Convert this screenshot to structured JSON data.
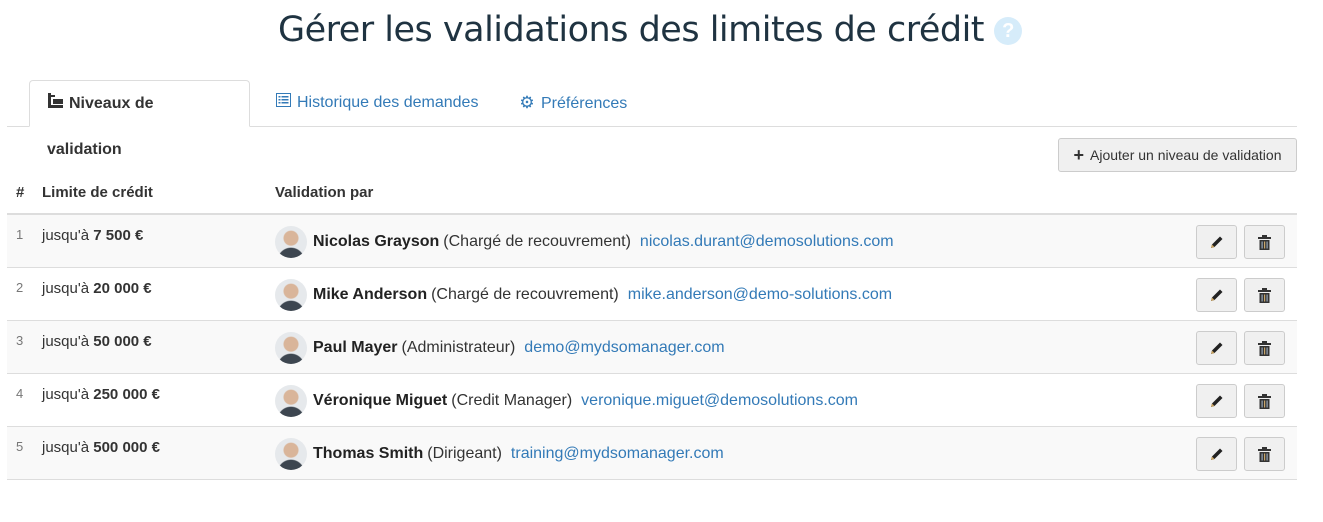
{
  "page": {
    "title": "Gérer les validations des limites de crédit",
    "help_icon": "question-circle-icon"
  },
  "tabs": [
    {
      "label": "Niveaux de validation",
      "icon": "sitemap-icon",
      "active": true
    },
    {
      "label": "Historique des demandes",
      "icon": "list-alt-icon",
      "active": false
    },
    {
      "label": "Préférences",
      "icon": "gear-icon",
      "active": false
    }
  ],
  "toolbar": {
    "add_label": "Ajouter un niveau de validation",
    "add_icon": "plus-icon"
  },
  "table": {
    "headers": {
      "num": "#",
      "limit": "Limite de crédit",
      "validator": "Validation par"
    },
    "rows": [
      {
        "num": "1",
        "prefix": "jusqu'à",
        "amount": "7 500 €",
        "name": "Nicolas Grayson",
        "role": "(Chargé de recouvrement)",
        "email": "nicolas.durant@demosolutions.com"
      },
      {
        "num": "2",
        "prefix": "jusqu'à",
        "amount": "20 000 €",
        "name": "Mike Anderson",
        "role": "(Chargé de recouvrement)",
        "email": "mike.anderson@demo-solutions.com"
      },
      {
        "num": "3",
        "prefix": "jusqu'à",
        "amount": "50 000 €",
        "name": "Paul Mayer",
        "role": "(Administrateur)",
        "email": "demo@mydsomanager.com"
      },
      {
        "num": "4",
        "prefix": "jusqu'à",
        "amount": "250 000 €",
        "name": "Véronique Miguet",
        "role": "(Credit Manager)",
        "email": "veronique.miguet@demosolutions.com"
      },
      {
        "num": "5",
        "prefix": "jusqu'à",
        "amount": "500 000 €",
        "name": "Thomas Smith",
        "role": "(Dirigeant)",
        "email": "training@mydsomanager.com"
      }
    ],
    "row_actions": {
      "edit_icon": "pencil-icon",
      "delete_icon": "trash-icon"
    }
  },
  "colors": {
    "link": "#337ab7",
    "title": "#1f3341",
    "help": "#d6ecfa"
  }
}
